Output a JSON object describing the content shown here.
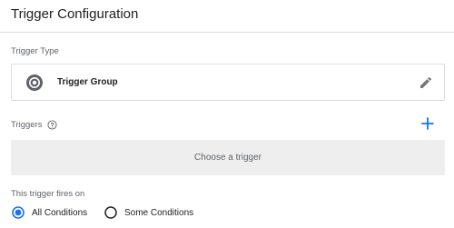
{
  "header": {
    "title": "Trigger Configuration"
  },
  "trigger_type": {
    "label": "Trigger Type",
    "selected": "Trigger Group",
    "icon": "trigger-group-icon",
    "edit_icon": "pencil-icon"
  },
  "triggers": {
    "label": "Triggers",
    "help_icon": "help-icon",
    "add_icon": "plus-icon",
    "placeholder": "Choose a trigger"
  },
  "fires_on": {
    "label": "This trigger fires on",
    "options": [
      {
        "label": "All Conditions",
        "selected": true
      },
      {
        "label": "Some Conditions",
        "selected": false
      }
    ]
  },
  "colors": {
    "accent": "#1a73e8",
    "icon_gray": "#5f6368",
    "border": "#dadce0",
    "panel_bg": "#eeeeee"
  }
}
